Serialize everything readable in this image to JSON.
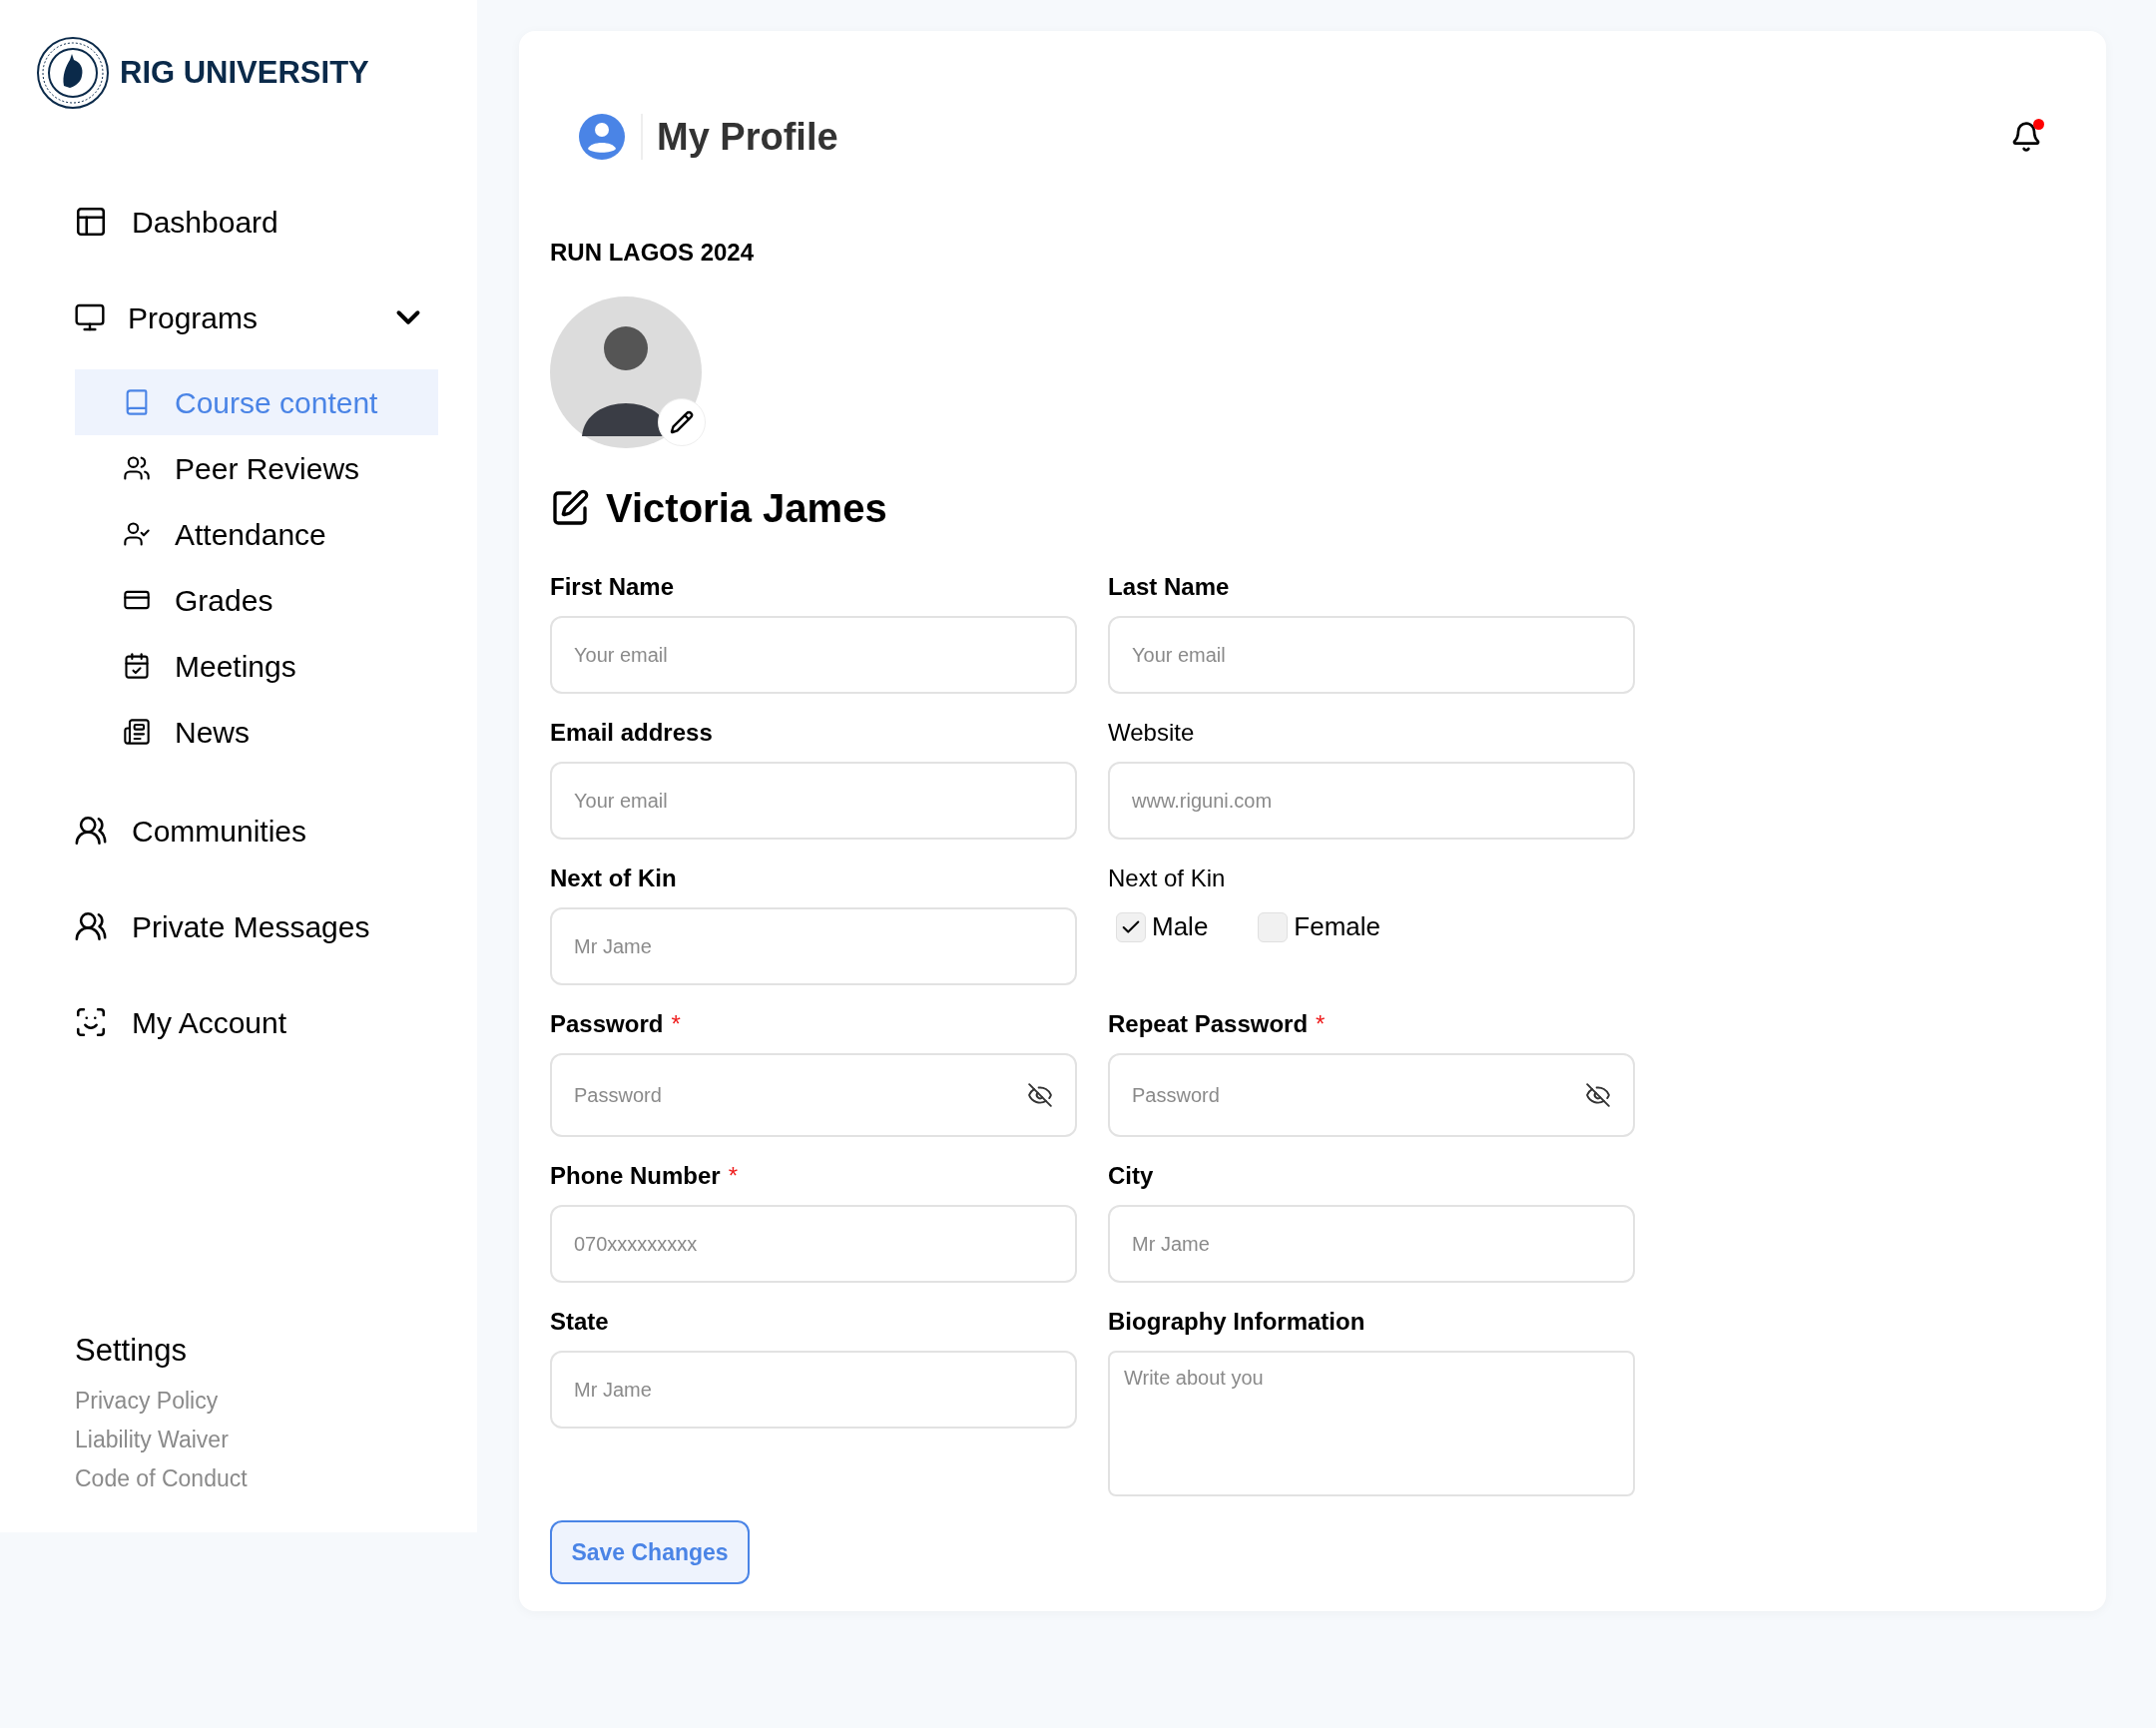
{
  "brand": {
    "name": "RIG UNIVERSITY"
  },
  "nav": [
    {
      "label": "Dashboard",
      "kind": "link"
    },
    {
      "label": "Programs",
      "kind": "group",
      "expanded": true,
      "children": [
        {
          "label": "Course content",
          "selected": true
        },
        {
          "label": "Peer Reviews",
          "selected": false
        },
        {
          "label": "Attendance",
          "selected": false
        },
        {
          "label": "Grades",
          "selected": false
        },
        {
          "label": "Meetings",
          "selected": false
        },
        {
          "label": "News",
          "selected": false
        }
      ]
    },
    {
      "label": "Communities",
      "kind": "link"
    },
    {
      "label": "Private Messages",
      "kind": "link"
    },
    {
      "label": "My Account",
      "kind": "link"
    }
  ],
  "settings": {
    "title": "Settings",
    "links": [
      "Privacy Policy",
      "Liability Waiver",
      "Code of Conduct"
    ]
  },
  "header": {
    "title": "My Profile",
    "unread": true
  },
  "profile": {
    "event": "RUN LAGOS 2024",
    "name": "Victoria James"
  },
  "fields": [
    {
      "label": "First Name",
      "kind": "text",
      "bold": true,
      "placeholder": "Your email"
    },
    {
      "label": "Last Name",
      "kind": "text",
      "bold": true,
      "placeholder": "Your email"
    },
    {
      "label": "Email address",
      "kind": "text",
      "bold": true,
      "placeholder": "Your email"
    },
    {
      "label": "Website",
      "kind": "text",
      "bold": false,
      "placeholder": "www.riguni.com"
    },
    {
      "label": "Next of Kin",
      "kind": "text",
      "bold": true,
      "placeholder": "Mr Jame"
    },
    {
      "label": "Next of Kin",
      "kind": "checkboxes",
      "bold": false,
      "options": [
        {
          "label": "Male",
          "checked": true
        },
        {
          "label": "Female",
          "checked": false
        }
      ]
    },
    {
      "label": "Password",
      "kind": "password",
      "bold": true,
      "required_mark": "*",
      "placeholder": "Password"
    },
    {
      "label": "Repeat Password",
      "kind": "password",
      "bold": true,
      "required_mark": "*",
      "placeholder": "Password"
    },
    {
      "label": "Phone Number",
      "kind": "text",
      "bold": true,
      "required_mark": "*",
      "placeholder": "070xxxxxxxxx"
    },
    {
      "label": "City",
      "kind": "text",
      "bold": true,
      "placeholder": "Mr Jame"
    },
    {
      "label": "State",
      "kind": "text",
      "bold": true,
      "placeholder": "Mr Jame"
    },
    {
      "label": "Biography Information",
      "kind": "textarea",
      "bold": true,
      "placeholder": "Write about you"
    }
  ],
  "save_button": "Save Changes"
}
